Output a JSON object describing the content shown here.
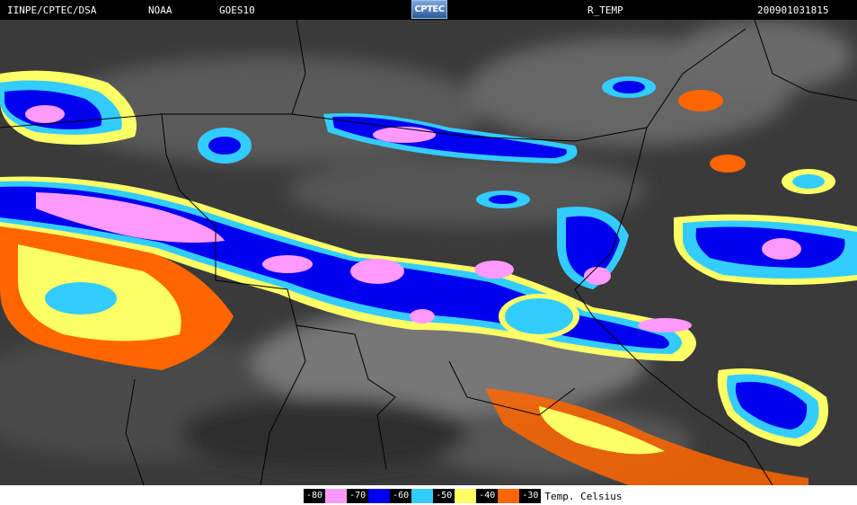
{
  "header": {
    "agency": "IINPE/CPTEC/DSA",
    "org": "NOAA",
    "satellite": "GOES10",
    "logo": "CPTEC",
    "product": "R_TEMP",
    "timestamp": "200901031815"
  },
  "legend": {
    "items": [
      {
        "label": "-80",
        "color": "#ff99ff"
      },
      {
        "label": "-70",
        "color": "#0000ee"
      },
      {
        "label": "-60",
        "color": "#33ccff"
      },
      {
        "label": "-50",
        "color": "#ffff66"
      },
      {
        "label": "-40",
        "color": "#ff6600"
      },
      {
        "label": "-30",
        "color": null
      }
    ],
    "unit": "Temp. Celsius"
  }
}
